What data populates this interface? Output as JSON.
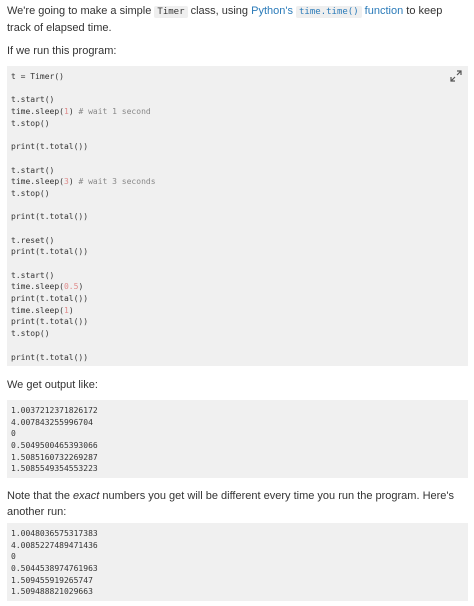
{
  "intro": {
    "before": "We're going to make a simple ",
    "code_class": "Timer",
    "middle": " class, using ",
    "link_text": "Python's ",
    "link_code": "time.time()",
    "link_after": " function",
    "after": " to keep track of elapsed time."
  },
  "run_label": "If we run this program:",
  "program": [
    {
      "text": "t = Timer()"
    },
    {
      "text": ""
    },
    {
      "text": "t.start()"
    },
    {
      "pre": "time.sleep(",
      "num": "1",
      "post": ") ",
      "comment": "# wait 1 second"
    },
    {
      "text": "t.stop()"
    },
    {
      "text": ""
    },
    {
      "text": "print(t.total())"
    },
    {
      "text": ""
    },
    {
      "text": "t.start()"
    },
    {
      "pre": "time.sleep(",
      "num": "3",
      "post": ") ",
      "comment": "# wait 3 seconds"
    },
    {
      "text": "t.stop()"
    },
    {
      "text": ""
    },
    {
      "text": "print(t.total())"
    },
    {
      "text": ""
    },
    {
      "text": "t.reset()"
    },
    {
      "text": "print(t.total())"
    },
    {
      "text": ""
    },
    {
      "text": "t.start()"
    },
    {
      "pre": "time.sleep(",
      "num": "0.5",
      "post": ")",
      "comment": ""
    },
    {
      "text": "print(t.total())"
    },
    {
      "pre": "time.sleep(",
      "num": "1",
      "post": ")",
      "comment": ""
    },
    {
      "text": "print(t.total())"
    },
    {
      "text": "t.stop()"
    },
    {
      "text": ""
    },
    {
      "text": "print(t.total())"
    }
  ],
  "expand_icon": "expand-arrows-icon",
  "output_label": "We get output like:",
  "output1": [
    "1.0037212371826172",
    "4.007843255996704",
    "0",
    "0.5049500465393066",
    "1.5085160732269287",
    "1.5085549354553223"
  ],
  "note": {
    "before": "Note that the ",
    "emphasis": "exact",
    "after": " numbers you get will be different every time you run the program. Here's another run:"
  },
  "output2": [
    "1.0048036575317383",
    "4.0085227489471436",
    "0",
    "0.5044538974761963",
    "1.509455919265747",
    "1.509488821029663"
  ],
  "colors": {
    "link": "#2b7bb9",
    "code_bg": "#f0f0f0",
    "number": "#e08a8a",
    "comment": "#888888"
  }
}
